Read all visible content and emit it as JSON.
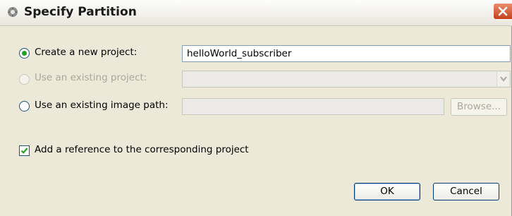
{
  "window": {
    "title": "Specify Partition"
  },
  "options": {
    "new_project": {
      "label": "Create a new project:",
      "value": "helloWorld_subscriber",
      "selected": true
    },
    "existing_project": {
      "label": "Use an existing project:",
      "value": "",
      "enabled": false
    },
    "image_path": {
      "label": "Use an existing image path:",
      "value": "",
      "browse_label": "Browse..."
    }
  },
  "reference_checkbox": {
    "label": "Add a reference to the corresponding project",
    "checked": true
  },
  "buttons": {
    "ok": "OK",
    "cancel": "Cancel"
  },
  "colors": {
    "radio_selected": "#21a121",
    "close_button": "#c5401d",
    "button_border": "#003c74"
  },
  "icons": {
    "title": "gear-icon",
    "close": "close-icon",
    "combo": "chevron-down-icon",
    "check": "checkmark-icon"
  }
}
